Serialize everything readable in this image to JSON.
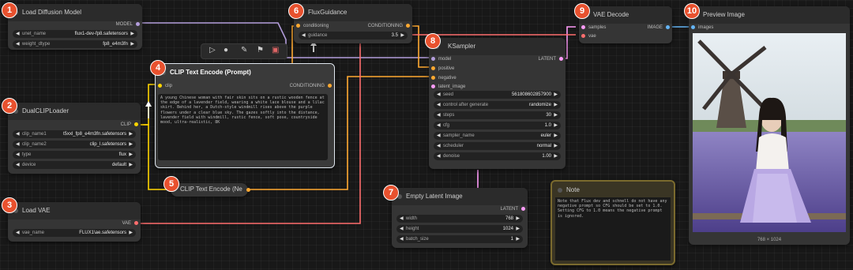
{
  "badges": [
    "1",
    "2",
    "3",
    "4",
    "5",
    "6",
    "7",
    "8",
    "9",
    "10"
  ],
  "nodes": {
    "load_diffusion": {
      "title": "Load Diffusion Model",
      "output": "MODEL",
      "widgets": [
        {
          "name": "unet_name",
          "value": "flux1-dev-fp8.safetensors"
        },
        {
          "name": "weight_dtype",
          "value": "fp8_e4m3fn"
        }
      ]
    },
    "dual_clip": {
      "title": "DualCLIPLoader",
      "output": "CLIP",
      "widgets": [
        {
          "name": "clip_name1",
          "value": "t5xxl_fp8_e4m3fn.safetensors"
        },
        {
          "name": "clip_name2",
          "value": "clip_l.safetensors"
        },
        {
          "name": "type",
          "value": "flux"
        },
        {
          "name": "device",
          "value": "default"
        }
      ]
    },
    "load_vae": {
      "title": "Load VAE",
      "output": "VAE",
      "widgets": [
        {
          "name": "vae_name",
          "value": "FLUX1\\ae.safetensors"
        }
      ]
    },
    "clip_encode": {
      "title": "CLIP Text Encode (Prompt)",
      "input": "clip",
      "output": "CONDITIONING",
      "text": "A young Chinese woman with fair skin sits on a rustic wooden fence at the edge of a lavender field, wearing a white lace blouse and a lilac skirt. Behind her, a Dutch-style windmill rises above the purple flowers under a clear blue sky. The gazes softly into the distance, lavender field with windmill, rustic fence, soft pose, countryside mood, ultra-realistic, 8K"
    },
    "clip_encode_neg": {
      "title": "CLIP Text Encode (Ne"
    },
    "flux_guidance": {
      "title": "FluxGuidance",
      "input": "conditioning",
      "output": "CONDITIONING",
      "widgets": [
        {
          "name": "guidance",
          "value": "3.5"
        }
      ]
    },
    "ksampler": {
      "title": "KSampler",
      "inputs": [
        "model",
        "positive",
        "negative",
        "latent_image"
      ],
      "output": "LATENT",
      "widgets": [
        {
          "name": "seed",
          "value": "561808602857900"
        },
        {
          "name": "control after generate",
          "value": "randomize"
        },
        {
          "name": "steps",
          "value": "30"
        },
        {
          "name": "cfg",
          "value": "1.0"
        },
        {
          "name": "sampler_name",
          "value": "euler"
        },
        {
          "name": "scheduler",
          "value": "normal"
        },
        {
          "name": "denoise",
          "value": "1.00"
        }
      ]
    },
    "empty_latent": {
      "title": "Empty Latent Image",
      "output": "LATENT",
      "widgets": [
        {
          "name": "width",
          "value": "768"
        },
        {
          "name": "height",
          "value": "1024"
        },
        {
          "name": "batch_size",
          "value": "1"
        }
      ]
    },
    "vae_decode": {
      "title": "VAE Decode",
      "inputs": [
        "samples",
        "vae"
      ],
      "output": "IMAGE"
    },
    "preview": {
      "title": "Preview Image",
      "input": "images",
      "caption": "768 × 1024"
    },
    "note": {
      "title": "Note",
      "text": "Note that Flux dev and schnell do not have any negative prompt so CFG should be set to 1.0. Setting CFG to 1.0 means the negative prompt is ignored."
    }
  },
  "colors": {
    "model": "#b39ddb",
    "clip": "#ffd500",
    "vae": "#ff6e6e",
    "conditioning": "#ffa931",
    "latent": "#ff9cf9",
    "image": "#64b5f6",
    "badge": "#e8512e"
  },
  "toolbar": {
    "icons": [
      "play-icon",
      "record-icon",
      "pin-icon",
      "bookmark-icon",
      "trash-icon"
    ]
  }
}
